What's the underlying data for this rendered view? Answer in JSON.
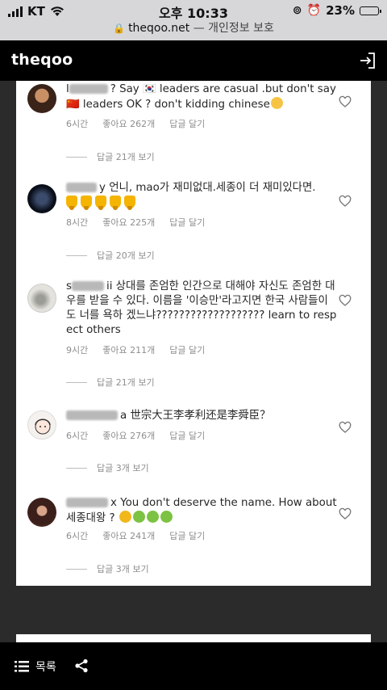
{
  "status": {
    "carrier": "KT",
    "time": "오후 10:33",
    "battery": "23%",
    "battery_level": 0.23
  },
  "browser": {
    "url": "theqoo.net",
    "separator": " — ",
    "subtitle": "개인정보 보호"
  },
  "nav": {
    "logo": "theqoo"
  },
  "comments": [
    {
      "user_visible": "l",
      "text": "? Say 🇰🇷 leaders are casual .but don't say🇨🇳 leaders OK ? don't kidding chinese",
      "time": "6시간",
      "likes": "좋아요 262개",
      "reply": "답글 달기",
      "more": "답글 21개 보기"
    },
    {
      "user_visible": "y",
      "text": "언니, mao가 재미없대.세종이 더 재미있다면.",
      "time": "8시간",
      "likes": "좋아요 225개",
      "reply": "답글 달기",
      "more": "답글 20개 보기"
    },
    {
      "user_visible": "s",
      "text": "ii 상대를 존엄한 인간으로 대해야 자신도 존엄한 대우를 받을 수 있다. 이름을 '이승만'라고지면 한국 사람들이 도 너를 욕하 겠느냐??????????????????? learn to respect others",
      "time": "9시간",
      "likes": "좋아요 211개",
      "reply": "답글 달기",
      "more": "답글 21개 보기"
    },
    {
      "user_visible": "a",
      "text": "世宗大王李孝利还是李舜臣？",
      "time": "6시간",
      "likes": "좋아요 276개",
      "reply": "답글 달기",
      "more": "답글 3개 보기"
    },
    {
      "user_visible": "x",
      "text": "You don't deserve the name. How about 세종대왕 ?",
      "time": "6시간",
      "likes": "좋아요 241개",
      "reply": "답글 달기",
      "more": "답글 3개 보기"
    }
  ],
  "bottom": {
    "list_label": "목록"
  },
  "icons": {
    "wifi": "wifi-icon",
    "lock": "lock-icon",
    "login": "login-icon",
    "heart": "heart-icon",
    "list": "list-icon",
    "share": "share-icon"
  }
}
